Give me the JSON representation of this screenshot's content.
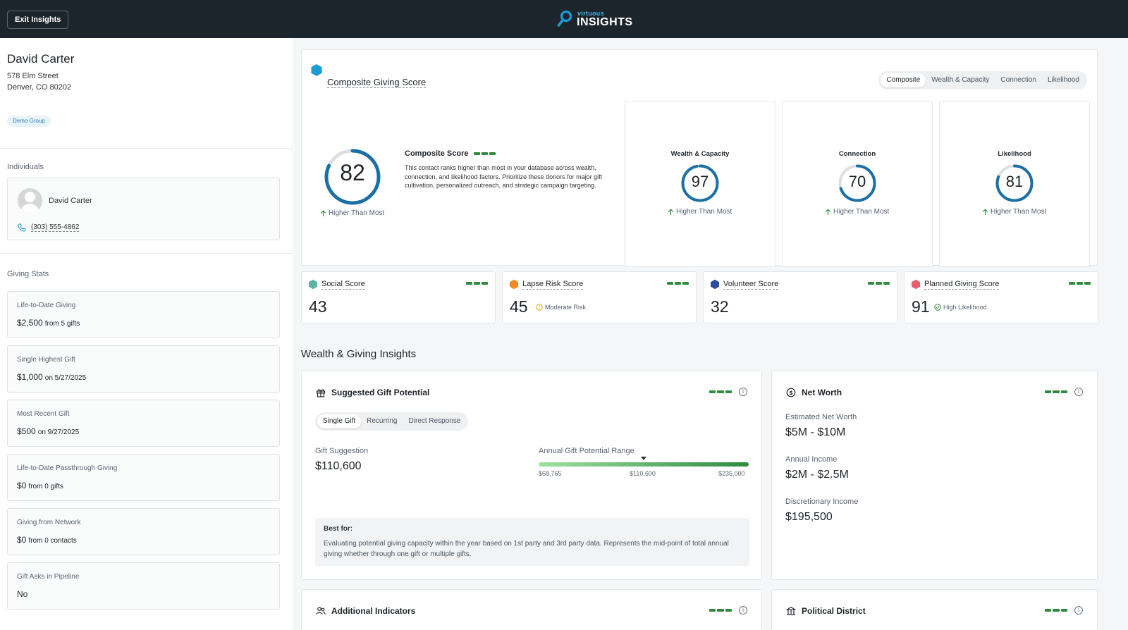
{
  "header": {
    "exit_label": "Exit Insights",
    "logo_small": "virtuous",
    "logo_big": "INSIGHTS"
  },
  "contact": {
    "name": "David Carter",
    "address_line1": "578 Elm Street",
    "address_line2": "Denver, CO 80202",
    "tag": "Demo Group"
  },
  "individuals": {
    "label": "Individuals",
    "name": "David Carter",
    "phone": "(303) 555-4862"
  },
  "giving_stats": {
    "label": "Giving Stats",
    "items": [
      {
        "label": "Life-to-Date Giving",
        "value": "$2,500",
        "detail": "from 5 gifts"
      },
      {
        "label": "Single Highest Gift",
        "value": "$1,000",
        "detail": "on 5/27/2025"
      },
      {
        "label": "Most Recent Gift",
        "value": "$500",
        "detail": "on 9/27/2025"
      },
      {
        "label": "Life-to-Date Passthrough Giving",
        "value": "$0",
        "detail": "from 0 gifts"
      },
      {
        "label": "Giving from Network",
        "value": "$0",
        "detail": "from 0 contacts"
      },
      {
        "label": "Gift Asks in Pipeline",
        "value": "No",
        "detail": ""
      }
    ]
  },
  "composite": {
    "title": "Composite Giving Score",
    "tabs": [
      "Composite",
      "Wealth & Capacity",
      "Connection",
      "Likelihood"
    ],
    "active_tab": "Composite",
    "score": 82,
    "score_label": "Composite Score",
    "trend": "Higher Than Most",
    "description": "This contact ranks higher than most in your database across wealth, connection, and likelihood factors. Prioritize these donors for major gift cultivation, personalized outreach, and strategic campaign targeting.",
    "sub_scores": [
      {
        "label": "Wealth & Capacity",
        "score": 97,
        "trend": "Higher Than Most"
      },
      {
        "label": "Connection",
        "score": 70,
        "trend": "Higher Than Most"
      },
      {
        "label": "Likelihood",
        "score": 81,
        "trend": "Higher Than Most"
      }
    ],
    "colors": {
      "ring": "#1a6fa5",
      "track": "#dcdfe3",
      "hex": "#1b9ad6"
    }
  },
  "scores": [
    {
      "title": "Social Score",
      "value": "43",
      "note": "",
      "color": "#5fb3a1"
    },
    {
      "title": "Lapse Risk Score",
      "value": "45",
      "note": "Moderate Risk",
      "color": "#f08a24"
    },
    {
      "title": "Volunteer Score",
      "value": "32",
      "note": "",
      "color": "#2f4a9e"
    },
    {
      "title": "Planned Giving Score",
      "value": "91",
      "note": "High Likelihood",
      "color": "#e8606e"
    }
  ],
  "wealth": {
    "heading": "Wealth & Giving Insights",
    "gift": {
      "title": "Suggested Gift Potential",
      "tabs": [
        "Single Gift",
        "Recurring",
        "Direct Response"
      ],
      "active_tab": "Single Gift",
      "suggestion_label": "Gift Suggestion",
      "suggestion_value": "$110,600",
      "range_label": "Annual Gift Potential Range",
      "range_min": "$68,765",
      "range_mid": "$110,600",
      "range_max": "$235,000",
      "best_for_label": "Best for:",
      "best_for_text": "Evaluating potential giving capacity within the year based on 1st party and 3rd party data. Represents the mid-point of total annual giving whether through one gift or multiple gifts."
    },
    "net_worth": {
      "title": "Net Worth",
      "items": [
        {
          "label": "Estimated Net Worth",
          "value": "$5M - $10M"
        },
        {
          "label": "Annual Income",
          "value": "$2M - $2.5M"
        },
        {
          "label": "Discretionary Income",
          "value": "$195,500"
        }
      ]
    },
    "additional_title": "Additional Indicators",
    "political_title": "Political District"
  }
}
